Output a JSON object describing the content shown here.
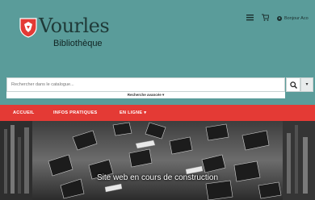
{
  "brand": {
    "name": "Vourles",
    "subtitle": "Bibliothèque",
    "accent": "#e43a35",
    "header_bg": "#5a9c9a"
  },
  "header": {
    "icons": [
      "menu-icon",
      "cart-icon"
    ],
    "account_label": "Bonjour Aco"
  },
  "search": {
    "placeholder": "Rechercher dans le catalogue...",
    "advanced_label": "Recherche avancée"
  },
  "nav": {
    "items": [
      {
        "label": "ACCUEIL"
      },
      {
        "label": "INFOS PRATIQUES"
      },
      {
        "label": "EN LIGNE ▾"
      }
    ]
  },
  "hero": {
    "title": "Site web en cours de construction"
  }
}
